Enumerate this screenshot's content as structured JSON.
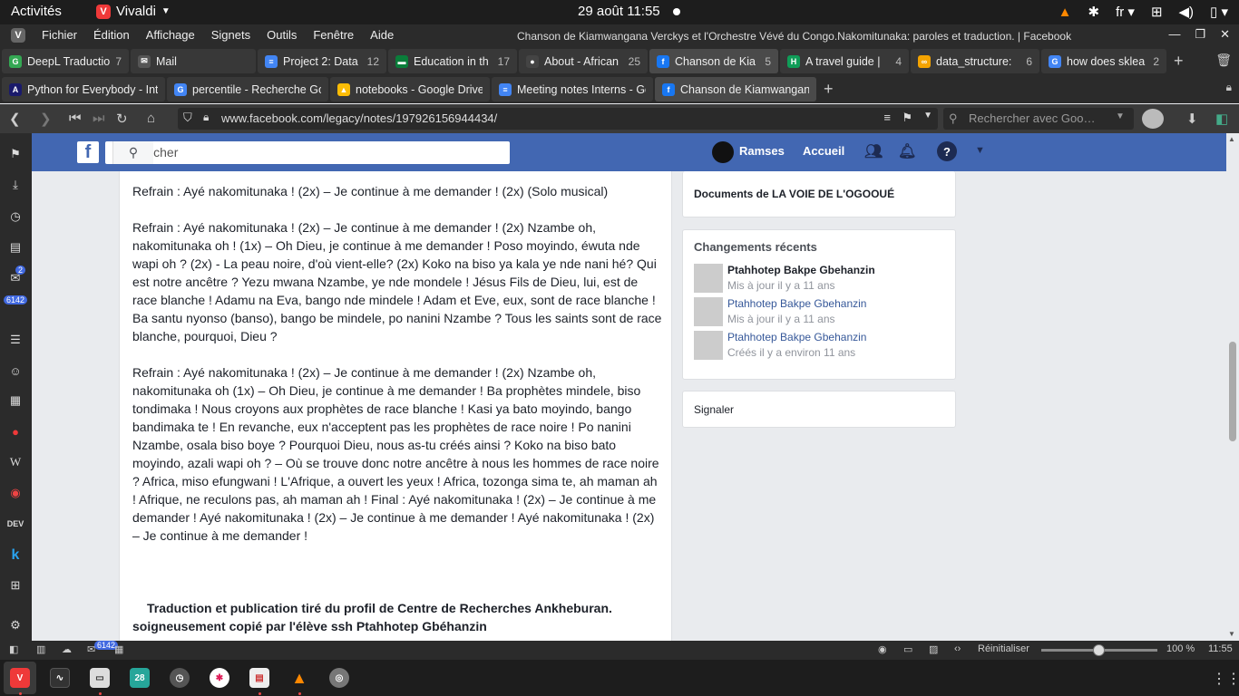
{
  "gnome": {
    "activities": "Activités",
    "app": "Vivaldi",
    "clock": "29 août  11:55",
    "lang": "fr"
  },
  "menu": {
    "items": [
      "Fichier",
      "Édition",
      "Affichage",
      "Signets",
      "Outils",
      "Fenêtre",
      "Aide"
    ],
    "window_title": "Chanson de Kiamwangana Verckys et l'Orchestre Vévé du Congo.Nakomitunaka: paroles et traduction. | Facebook"
  },
  "tabs_row1": [
    {
      "label": "DeepL Traductio",
      "count": "7",
      "color": "#34a853",
      "icon": "G"
    },
    {
      "label": "Mail",
      "count": "",
      "color": "#555",
      "icon": "✉"
    },
    {
      "label": "Project 2: Data",
      "count": "12",
      "color": "#4285f4",
      "icon": "≡"
    },
    {
      "label": "Education in th",
      "count": "17",
      "color": "#0a7d3a",
      "icon": "▬"
    },
    {
      "label": "About - African",
      "count": "25",
      "color": "#444",
      "icon": "●"
    },
    {
      "label": "Chanson de Kia",
      "count": "5",
      "color": "#1877f2",
      "icon": "f"
    },
    {
      "label": "A travel guide |",
      "count": "4",
      "color": "#0f9d58",
      "icon": "H"
    },
    {
      "label": "data_structure:",
      "count": "6",
      "color": "#f4a300",
      "icon": "∞"
    },
    {
      "label": "how does sklea",
      "count": "2",
      "color": "#4285f4",
      "icon": "G"
    }
  ],
  "tabs_row2": [
    {
      "label": "Python for Everybody - Intr",
      "color": "#1a1a6b",
      "icon": "A"
    },
    {
      "label": "percentile - Recherche Goo",
      "color": "#4285f4",
      "icon": "G"
    },
    {
      "label": "notebooks - Google Drive",
      "color": "#fbbc05",
      "icon": "▲"
    },
    {
      "label": "Meeting notes Interns - Go",
      "color": "#4285f4",
      "icon": "≡"
    },
    {
      "label": "Chanson de Kiamwangana",
      "color": "#1877f2",
      "icon": "f"
    }
  ],
  "nav": {
    "url": "www.facebook.com/legacy/notes/197926156944434/",
    "search_placeholder": "Rechercher avec Goo…"
  },
  "sidepanel": {
    "badge_mail": "2",
    "badge_feed": "6142"
  },
  "fb": {
    "search_placeholder": "Rechercher",
    "user": "Ramses",
    "home": "Accueil"
  },
  "note": {
    "p1": "Refrain : Ayé nakomitunaka ! (2x) – Je continue à me demander ! (2x) (Solo musical)",
    "p2": "Refrain : Ayé nakomitunaka ! (2x) – Je continue à me demander ! (2x) Nzambe oh, nakomitunaka oh ! (1x) – Oh Dieu, je continue à me demander ! Poso moyindo, éwuta nde wapi oh ? (2x) - La peau noire, d'où vient-elle? (2x) Koko na biso ya kala ye nde nani hé? Qui est notre ancêtre ? Yezu mwana Nzambe, ye nde mondele ! Jésus Fils de Dieu, lui, est de race blanche ! Adamu na Eva, bango nde mindele ! Adam et Eve, eux, sont de race blanche ! Ba santu nyonso (banso), bango be mindele, po nanini Nzambe ? Tous les saints sont de race blanche, pourquoi, Dieu ?",
    "p3": "Refrain : Ayé nakomitunaka ! (2x) – Je continue à me demander ! (2x) Nzambe oh, nakomitunaka oh (1x) – Oh Dieu, je continue à me demander ! Ba prophètes mindele, biso tondimaka ! Nous croyons aux prophètes de race blanche ! Kasi ya bato moyindo, bango bandimaka te ! En revanche, eux n'acceptent pas les prophètes de race noire ! Po nanini Nzambe, osala biso boye ? Pourquoi Dieu, nous as-tu créés ainsi ? Koko na biso bato moyindo, azali wapi oh ? – Où se trouve donc notre ancêtre à nous les hommes de race noire ? Africa, miso efungwani ! L'Afrique, a ouvert les yeux ! Africa, tozonga sima te, ah maman ah ! Afrique, ne reculons pas, ah maman ah ! Final : Ayé nakomitunaka ! (2x) – Je continue à me demander ! Ayé nakomitunaka ! (2x) – Je continue à me demander ! Ayé nakomitunaka ! (2x) – Je continue à me demander !",
    "credit": "Traduction et publication tiré du profil de Centre de Recherches Ankheburan. soigneusement copié par l'élève ssh Ptahhotep Gbéhanzin"
  },
  "right": {
    "docs": "Documents de LA VOIE DE L'OGOOUÉ",
    "recent_title": "Changements récents",
    "recent": [
      {
        "name": "Ptahhotep Bakpe Gbehanzin",
        "sub": "Mis à jour il y a 11 ans",
        "bold": true
      },
      {
        "name": "Ptahhotep Bakpe Gbehanzin",
        "sub": "Mis à jour il y a 11 ans",
        "bold": false
      },
      {
        "name": "Ptahhotep Bakpe Gbehanzin",
        "sub": "Créés il y a environ 11 ans",
        "bold": false
      }
    ],
    "report": "Signaler"
  },
  "status": {
    "reset": "Réinitialiser",
    "zoom": "100 %",
    "time": "11:55",
    "badge": "6142",
    "zoom_level": 0.5
  },
  "dock": {
    "calendar_day": "28"
  }
}
